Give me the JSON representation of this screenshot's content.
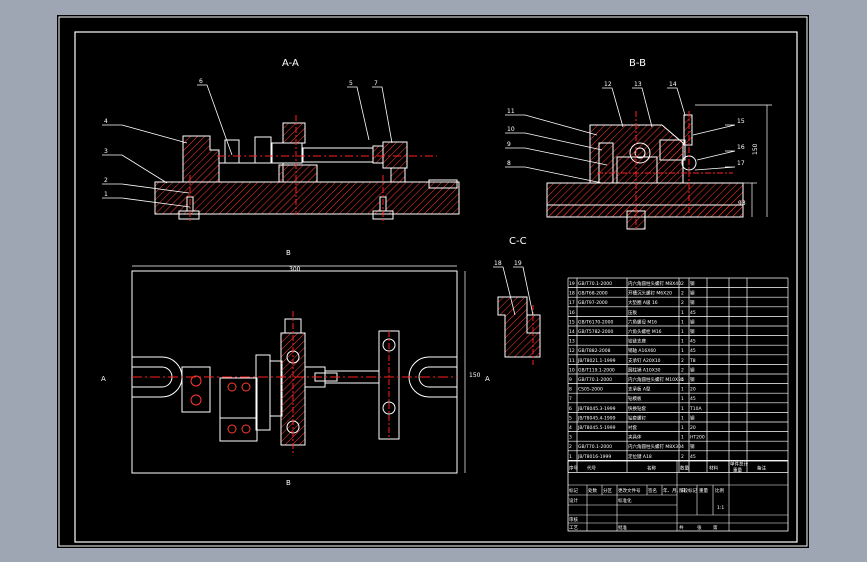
{
  "drawing": {
    "views": {
      "section_a": "A-A",
      "section_b": "B-B",
      "section_c": "C-C"
    },
    "callouts_a": [
      "1",
      "2",
      "3",
      "4",
      "5",
      "6",
      "7"
    ],
    "callouts_b": [
      "8",
      "9",
      "10",
      "11",
      "12",
      "13",
      "14",
      "15",
      "16",
      "17"
    ],
    "callouts_c": [
      "18",
      "19"
    ],
    "plan_markers": {
      "a_left": "A",
      "a_right": "A",
      "b_top": "B",
      "b_bottom": "B",
      "c_mark": "C"
    },
    "dims": {
      "overall_width": "300",
      "height_right": "150",
      "height_b": "93"
    }
  },
  "bom": {
    "rows": [
      {
        "no": "19",
        "code": "GB/T70.1-2000",
        "name": "内六角圆柱头螺钉 M8X40",
        "qty": "2",
        "mat": "钢"
      },
      {
        "no": "18",
        "code": "GB/T68-2000",
        "name": "开槽沉头螺钉 M6X20",
        "qty": "2",
        "mat": "钢"
      },
      {
        "no": "17",
        "code": "GB/T97-2000",
        "name": "大垫圈 A级 16",
        "qty": "2",
        "mat": "钢"
      },
      {
        "no": "16",
        "code": "",
        "name": "压板",
        "qty": "1",
        "mat": "45"
      },
      {
        "no": "15",
        "code": "GB/T6170-2000",
        "name": "六角螺母 M16",
        "qty": "1",
        "mat": "钢"
      },
      {
        "no": "14",
        "code": "GB/T5782-2000",
        "name": "六角头螺栓 M16",
        "qty": "1",
        "mat": "钢"
      },
      {
        "no": "13",
        "code": "",
        "name": "铰链支座",
        "qty": "1",
        "mat": "45"
      },
      {
        "no": "12",
        "code": "GB/T882-2008",
        "name": "销轴 A16X60",
        "qty": "1",
        "mat": "45"
      },
      {
        "no": "11",
        "code": "JB/T8021.1-1999",
        "name": "支承钉 A20X10",
        "qty": "2",
        "mat": "T8"
      },
      {
        "no": "10",
        "code": "GB/T119.1-2000",
        "name": "圆柱销 A10X30",
        "qty": "2",
        "mat": "钢"
      },
      {
        "no": "9",
        "code": "GB/T70.1-2000",
        "name": "内六角圆柱头螺钉 M10X35",
        "qty": "4",
        "mat": "钢"
      },
      {
        "no": "8",
        "code": "CS05-2000",
        "name": "支承板 A型",
        "qty": "1",
        "mat": "20"
      },
      {
        "no": "7",
        "code": "",
        "name": "钻模板",
        "qty": "1",
        "mat": "45"
      },
      {
        "no": "6",
        "code": "JB/T8045.3-1999",
        "name": "快换钻套",
        "qty": "1",
        "mat": "T10A"
      },
      {
        "no": "5",
        "code": "JB/T8045.4-1999",
        "name": "钻套螺钉",
        "qty": "1",
        "mat": "钢"
      },
      {
        "no": "4",
        "code": "JB/T8045.5-1999",
        "name": "衬套",
        "qty": "1",
        "mat": "20"
      },
      {
        "no": "3",
        "code": "",
        "name": "夹具体",
        "qty": "1",
        "mat": "HT200"
      },
      {
        "no": "2",
        "code": "GB/T70.1-2000",
        "name": "内六角圆柱头螺钉 M8X30",
        "qty": "4",
        "mat": "钢"
      },
      {
        "no": "1",
        "code": "JB/T8016-1999",
        "name": "定位键 A18",
        "qty": "2",
        "mat": "45"
      }
    ],
    "header": {
      "no": "序号",
      "code": "代号",
      "name": "名称",
      "qty": "数量",
      "mat": "材料",
      "unit_weight": "单件",
      "total_weight": "总计",
      "weight": "重量",
      "remark": "备注"
    }
  },
  "title_block": {
    "mark": "标记",
    "count": "处数",
    "zone": "分区",
    "change_doc": "更改文件号",
    "sign": "签名",
    "date": "年、月、日",
    "design": "设计",
    "standardize": "标准化",
    "review": "审核",
    "process": "工艺",
    "approve": "批准",
    "stage": "阶段标记",
    "weight": "重量",
    "scale": "比例",
    "scale_val": "1:1",
    "sheets": "共",
    "sheet_of": "张",
    "sheet_no": "第"
  },
  "colors": {
    "background": "#000000",
    "frame": "#ffffff",
    "hatch": "#ff3b30",
    "center": "#ff2020",
    "part": "#ffffff",
    "dim": "#ffffff",
    "page": "#9ea6b4"
  }
}
